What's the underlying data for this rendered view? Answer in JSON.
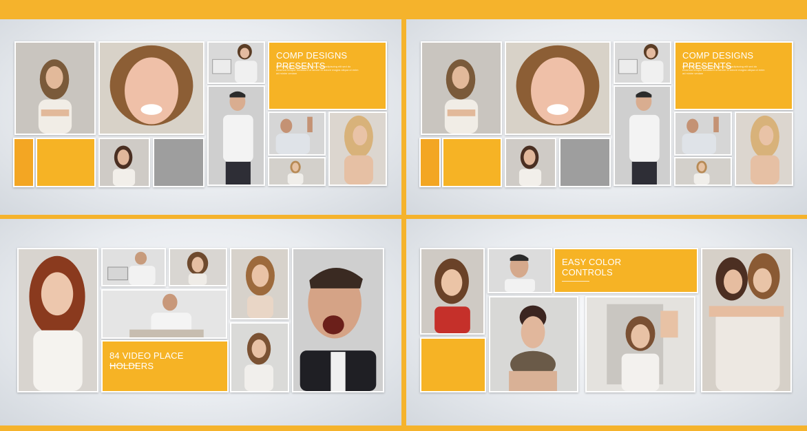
{
  "colors": {
    "accent": "#f6b325",
    "accent_dark": "#f3a623",
    "placeholder_gray": "#9e9e9e",
    "frame": "#ffffff",
    "background": "#e9ecf0"
  },
  "panels": [
    {
      "id": "top-left",
      "caption": "COMP DESIGNS PRESENTS",
      "body_text": "Lorem ipsum dolor sit amet consectetur adipiscing elit sed do eiusmod tempor incididunt ut labore et dolore magna aliqua ut enim ad minim veniam"
    },
    {
      "id": "top-right",
      "caption": "COMP DESIGNS PRESENTS",
      "body_text": "Lorem ipsum dolor sit amet consectetur adipiscing elit sed do eiusmod tempor incididunt ut labore et dolore magna aliqua ut enim ad minim veniam"
    },
    {
      "id": "bottom-left",
      "caption": "84 VIDEO PLACE HOLDERS"
    },
    {
      "id": "bottom-right",
      "caption_line1": "EASY COLOR",
      "caption_line2": "CONTROLS"
    }
  ]
}
